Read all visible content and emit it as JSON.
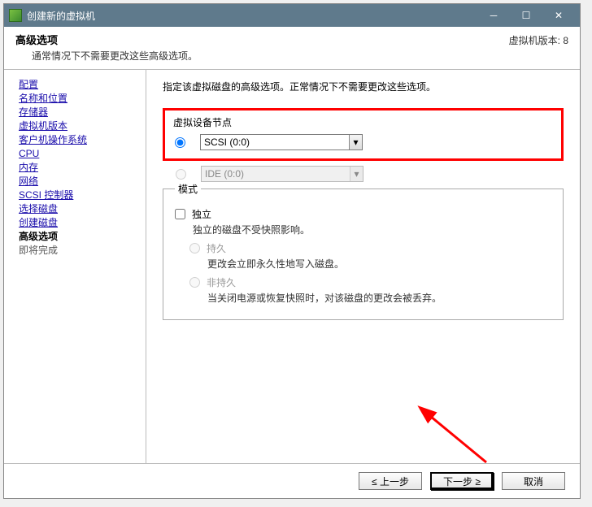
{
  "titlebar": {
    "title": "创建新的虚拟机"
  },
  "header": {
    "title": "高级选项",
    "subtitle": "通常情况下不需要更改这些高级选项。",
    "version": "虚拟机版本: 8"
  },
  "sidebar": {
    "items": [
      {
        "label": "配置",
        "state": "link"
      },
      {
        "label": "名称和位置",
        "state": "link"
      },
      {
        "label": "存储器",
        "state": "link"
      },
      {
        "label": "虚拟机版本",
        "state": "link"
      },
      {
        "label": "客户机操作系统",
        "state": "link"
      },
      {
        "label": "CPU",
        "state": "link"
      },
      {
        "label": "内存",
        "state": "link"
      },
      {
        "label": "网络",
        "state": "link"
      },
      {
        "label": "SCSI 控制器",
        "state": "link"
      },
      {
        "label": "选择磁盘",
        "state": "link"
      },
      {
        "label": "创建磁盘",
        "state": "link"
      },
      {
        "label": "高级选项",
        "state": "current"
      },
      {
        "label": "即将完成",
        "state": "pending"
      }
    ]
  },
  "content": {
    "instruction": "指定该虚拟磁盘的高级选项。正常情况下不需要更改这些选项。",
    "device_node": {
      "legend": "虚拟设备节点",
      "scsi_value": "SCSI (0:0)",
      "ide_value": "IDE (0:0)"
    },
    "mode": {
      "legend": "模式",
      "independent_label": "独立",
      "independent_desc": "独立的磁盘不受快照影响。",
      "persistent_label": "持久",
      "persistent_desc": "更改会立即永久性地写入磁盘。",
      "nonpersistent_label": "非持久",
      "nonpersistent_desc": "当关闭电源或恢复快照时，对该磁盘的更改会被丢弃。"
    }
  },
  "footer": {
    "back_label": "≤ 上一步",
    "next_label": "下一步 ≥",
    "cancel_label": "取消"
  }
}
